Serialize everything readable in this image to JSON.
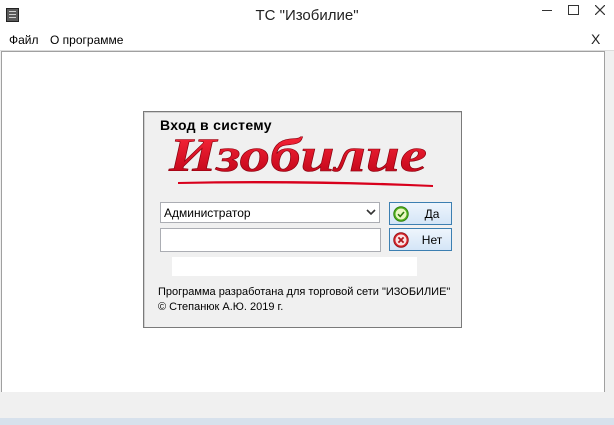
{
  "window": {
    "title": "ТС \"Изобилие\"",
    "menu": [
      {
        "label": "Файл"
      },
      {
        "label": "О программе"
      }
    ],
    "menu_close": "X"
  },
  "login": {
    "heading": "Вход в систему",
    "logo_text": "Изобилие",
    "user_value": "Администратор",
    "password_value": "",
    "ok_label": "Да",
    "cancel_label": "Нет",
    "credit_line1": "Программа разработана для торговой сети \"ИЗОБИЛИЕ\"",
    "credit_line2": "© Степанюк А.Ю. 2019 г."
  },
  "colors": {
    "logo_red": "#d8001c",
    "ok_icon": "#4fae1c",
    "cancel_icon": "#d8252c",
    "button_border": "#3c7fb1"
  },
  "icons": {
    "ok": "check-circle-icon",
    "cancel": "x-circle-icon"
  }
}
